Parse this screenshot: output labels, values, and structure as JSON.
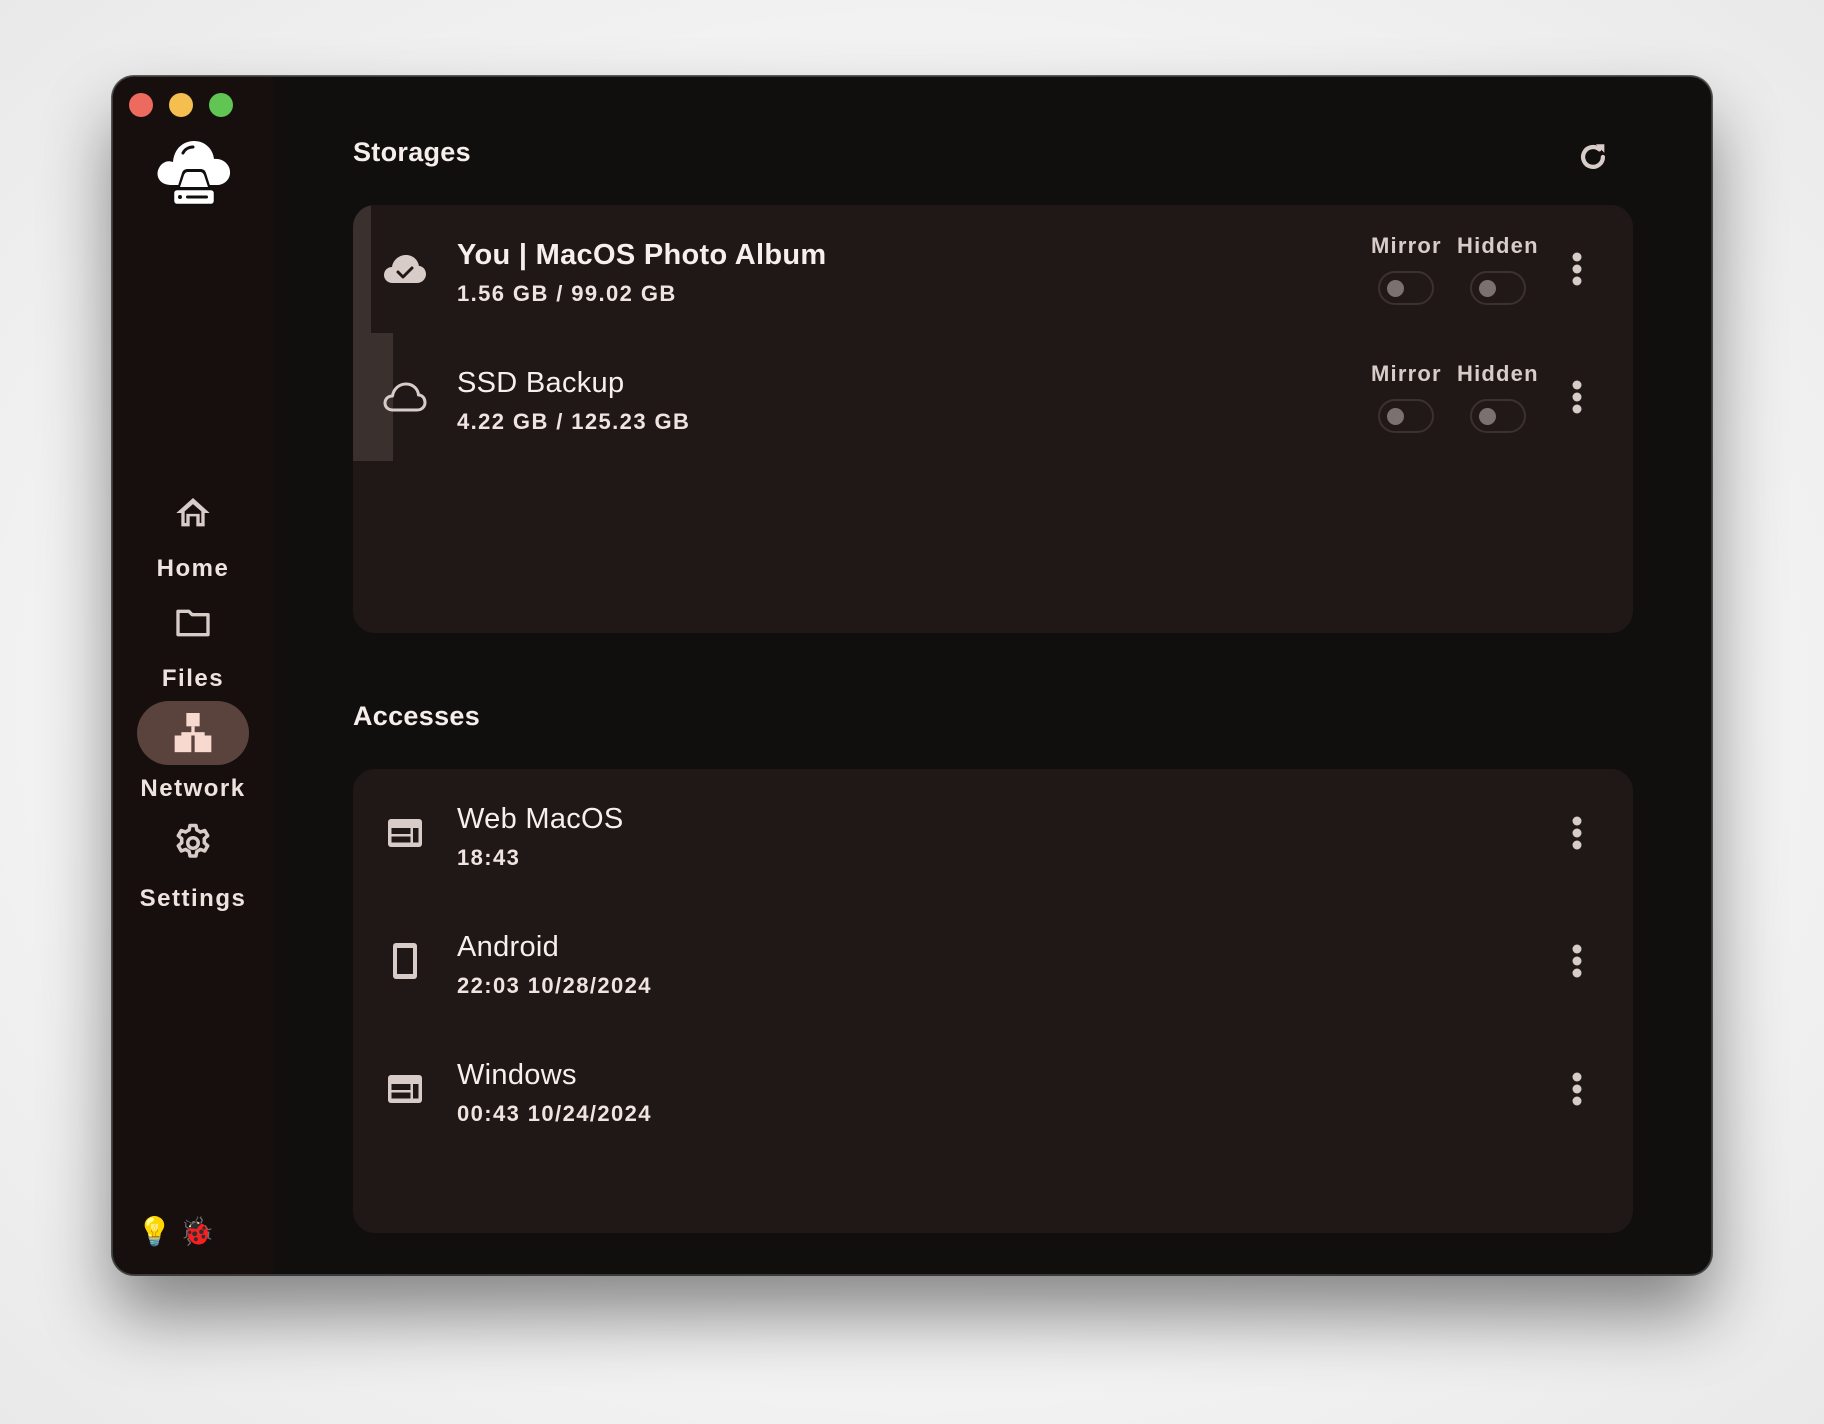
{
  "window": {
    "traffic_lights": [
      "close",
      "minimize",
      "maximize"
    ]
  },
  "sidebar": {
    "logo_icon": "cloud-drive-icon",
    "items": [
      {
        "label": "Home",
        "icon": "home-icon",
        "active": false
      },
      {
        "label": "Files",
        "icon": "folder-icon",
        "active": false
      },
      {
        "label": "Network",
        "icon": "network-icon",
        "active": true
      },
      {
        "label": "Settings",
        "icon": "gear-icon",
        "active": false
      }
    ],
    "footer": {
      "bulb": "💡",
      "bug": "🐞"
    }
  },
  "storages": {
    "title": "Storages",
    "refresh_icon": "refresh-icon",
    "items": [
      {
        "name": "You | MacOS Photo Album",
        "usage": "1.56 GB / 99.02 GB",
        "icon": "cloud-check-icon",
        "mirror_label": "Mirror",
        "hidden_label": "Hidden",
        "mirror": false,
        "hidden": false
      },
      {
        "name": "SSD Backup",
        "usage": "4.22 GB / 125.23 GB",
        "icon": "cloud-outline-icon",
        "mirror_label": "Mirror",
        "hidden_label": "Hidden",
        "mirror": false,
        "hidden": false
      }
    ]
  },
  "accesses": {
    "title": "Accesses",
    "items": [
      {
        "name": "Web MacOS",
        "time": "18:43",
        "icon": "browser-window-icon"
      },
      {
        "name": "Android",
        "time": "22:03 10/28/2024",
        "icon": "phone-icon"
      },
      {
        "name": "Windows",
        "time": "00:43 10/24/2024",
        "icon": "browser-window-icon"
      }
    ]
  },
  "colors": {
    "window_bg": "#110f0e",
    "sidebar_bg": "#170f0e",
    "card_bg": "#201817",
    "active_pill": "#5a433c",
    "text": "#f6eeeb",
    "icon": "#d8ccc8"
  }
}
